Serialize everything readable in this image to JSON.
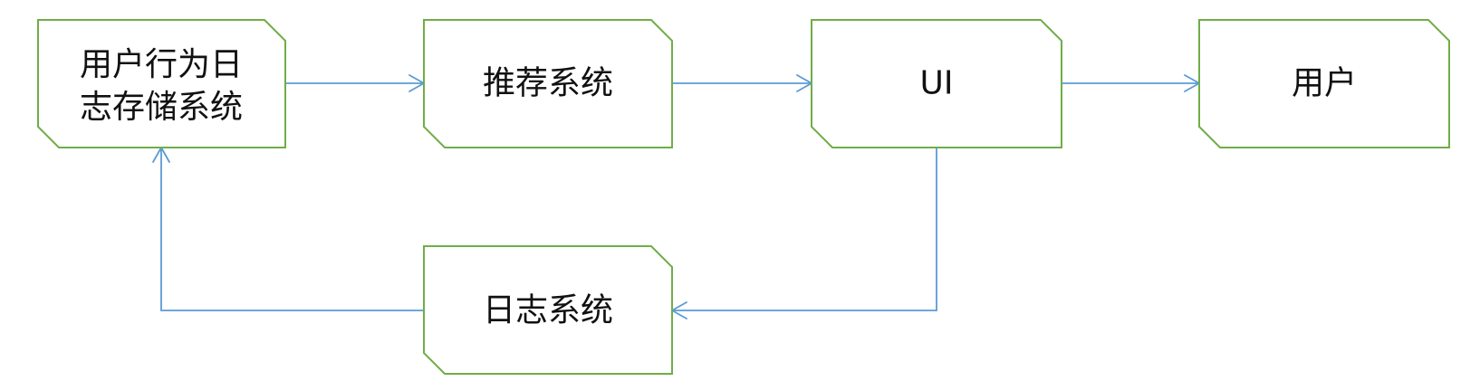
{
  "diagram": {
    "nodes": {
      "log_storage": {
        "line1": "用户行为日",
        "line2": "志存储系统"
      },
      "recommend": {
        "label": "推荐系统"
      },
      "ui": {
        "label": "UI"
      },
      "user": {
        "label": "用户"
      },
      "log_system": {
        "label": "日志系统"
      }
    },
    "edges": [
      {
        "from": "log_storage",
        "to": "recommend"
      },
      {
        "from": "recommend",
        "to": "ui"
      },
      {
        "from": "ui",
        "to": "user"
      },
      {
        "from": "ui",
        "to": "log_system"
      },
      {
        "from": "log_system",
        "to": "log_storage"
      }
    ],
    "colors": {
      "box_border": "#70ad47",
      "connector": "#5b9bd5",
      "text": "#111111"
    }
  }
}
